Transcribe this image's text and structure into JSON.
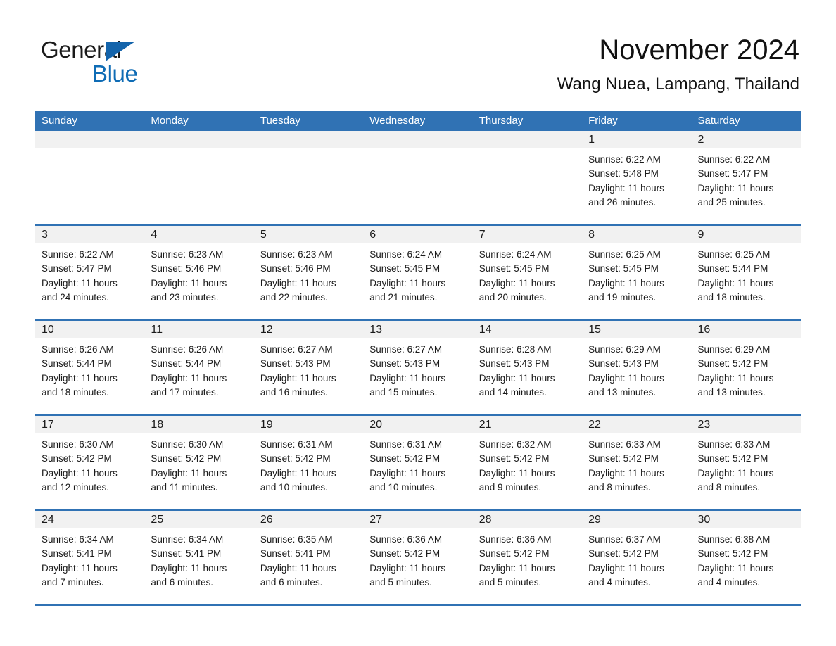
{
  "brand": {
    "name_part1": "General",
    "name_part2": "Blue",
    "triangle_icon": "blue-triangle-icon",
    "colors": {
      "black": "#1a1a1a",
      "blue": "#0f6cb5",
      "header_blue": "#3072b4",
      "day_strip_gray": "#f1f1f1"
    }
  },
  "header": {
    "month_title": "November 2024",
    "location": "Wang Nuea, Lampang, Thailand"
  },
  "calendar": {
    "weekdays": [
      "Sunday",
      "Monday",
      "Tuesday",
      "Wednesday",
      "Thursday",
      "Friday",
      "Saturday"
    ],
    "weeks": [
      [
        {
          "day": "",
          "sunrise": "",
          "sunset": "",
          "daylight_line1": "",
          "daylight_line2": "",
          "empty": true
        },
        {
          "day": "",
          "sunrise": "",
          "sunset": "",
          "daylight_line1": "",
          "daylight_line2": "",
          "empty": true
        },
        {
          "day": "",
          "sunrise": "",
          "sunset": "",
          "daylight_line1": "",
          "daylight_line2": "",
          "empty": true
        },
        {
          "day": "",
          "sunrise": "",
          "sunset": "",
          "daylight_line1": "",
          "daylight_line2": "",
          "empty": true
        },
        {
          "day": "",
          "sunrise": "",
          "sunset": "",
          "daylight_line1": "",
          "daylight_line2": "",
          "empty": true
        },
        {
          "day": "1",
          "sunrise": "Sunrise: 6:22 AM",
          "sunset": "Sunset: 5:48 PM",
          "daylight_line1": "Daylight: 11 hours",
          "daylight_line2": "and 26 minutes.",
          "empty": false
        },
        {
          "day": "2",
          "sunrise": "Sunrise: 6:22 AM",
          "sunset": "Sunset: 5:47 PM",
          "daylight_line1": "Daylight: 11 hours",
          "daylight_line2": "and 25 minutes.",
          "empty": false
        }
      ],
      [
        {
          "day": "3",
          "sunrise": "Sunrise: 6:22 AM",
          "sunset": "Sunset: 5:47 PM",
          "daylight_line1": "Daylight: 11 hours",
          "daylight_line2": "and 24 minutes.",
          "empty": false
        },
        {
          "day": "4",
          "sunrise": "Sunrise: 6:23 AM",
          "sunset": "Sunset: 5:46 PM",
          "daylight_line1": "Daylight: 11 hours",
          "daylight_line2": "and 23 minutes.",
          "empty": false
        },
        {
          "day": "5",
          "sunrise": "Sunrise: 6:23 AM",
          "sunset": "Sunset: 5:46 PM",
          "daylight_line1": "Daylight: 11 hours",
          "daylight_line2": "and 22 minutes.",
          "empty": false
        },
        {
          "day": "6",
          "sunrise": "Sunrise: 6:24 AM",
          "sunset": "Sunset: 5:45 PM",
          "daylight_line1": "Daylight: 11 hours",
          "daylight_line2": "and 21 minutes.",
          "empty": false
        },
        {
          "day": "7",
          "sunrise": "Sunrise: 6:24 AM",
          "sunset": "Sunset: 5:45 PM",
          "daylight_line1": "Daylight: 11 hours",
          "daylight_line2": "and 20 minutes.",
          "empty": false
        },
        {
          "day": "8",
          "sunrise": "Sunrise: 6:25 AM",
          "sunset": "Sunset: 5:45 PM",
          "daylight_line1": "Daylight: 11 hours",
          "daylight_line2": "and 19 minutes.",
          "empty": false
        },
        {
          "day": "9",
          "sunrise": "Sunrise: 6:25 AM",
          "sunset": "Sunset: 5:44 PM",
          "daylight_line1": "Daylight: 11 hours",
          "daylight_line2": "and 18 minutes.",
          "empty": false
        }
      ],
      [
        {
          "day": "10",
          "sunrise": "Sunrise: 6:26 AM",
          "sunset": "Sunset: 5:44 PM",
          "daylight_line1": "Daylight: 11 hours",
          "daylight_line2": "and 18 minutes.",
          "empty": false
        },
        {
          "day": "11",
          "sunrise": "Sunrise: 6:26 AM",
          "sunset": "Sunset: 5:44 PM",
          "daylight_line1": "Daylight: 11 hours",
          "daylight_line2": "and 17 minutes.",
          "empty": false
        },
        {
          "day": "12",
          "sunrise": "Sunrise: 6:27 AM",
          "sunset": "Sunset: 5:43 PM",
          "daylight_line1": "Daylight: 11 hours",
          "daylight_line2": "and 16 minutes.",
          "empty": false
        },
        {
          "day": "13",
          "sunrise": "Sunrise: 6:27 AM",
          "sunset": "Sunset: 5:43 PM",
          "daylight_line1": "Daylight: 11 hours",
          "daylight_line2": "and 15 minutes.",
          "empty": false
        },
        {
          "day": "14",
          "sunrise": "Sunrise: 6:28 AM",
          "sunset": "Sunset: 5:43 PM",
          "daylight_line1": "Daylight: 11 hours",
          "daylight_line2": "and 14 minutes.",
          "empty": false
        },
        {
          "day": "15",
          "sunrise": "Sunrise: 6:29 AM",
          "sunset": "Sunset: 5:43 PM",
          "daylight_line1": "Daylight: 11 hours",
          "daylight_line2": "and 13 minutes.",
          "empty": false
        },
        {
          "day": "16",
          "sunrise": "Sunrise: 6:29 AM",
          "sunset": "Sunset: 5:42 PM",
          "daylight_line1": "Daylight: 11 hours",
          "daylight_line2": "and 13 minutes.",
          "empty": false
        }
      ],
      [
        {
          "day": "17",
          "sunrise": "Sunrise: 6:30 AM",
          "sunset": "Sunset: 5:42 PM",
          "daylight_line1": "Daylight: 11 hours",
          "daylight_line2": "and 12 minutes.",
          "empty": false
        },
        {
          "day": "18",
          "sunrise": "Sunrise: 6:30 AM",
          "sunset": "Sunset: 5:42 PM",
          "daylight_line1": "Daylight: 11 hours",
          "daylight_line2": "and 11 minutes.",
          "empty": false
        },
        {
          "day": "19",
          "sunrise": "Sunrise: 6:31 AM",
          "sunset": "Sunset: 5:42 PM",
          "daylight_line1": "Daylight: 11 hours",
          "daylight_line2": "and 10 minutes.",
          "empty": false
        },
        {
          "day": "20",
          "sunrise": "Sunrise: 6:31 AM",
          "sunset": "Sunset: 5:42 PM",
          "daylight_line1": "Daylight: 11 hours",
          "daylight_line2": "and 10 minutes.",
          "empty": false
        },
        {
          "day": "21",
          "sunrise": "Sunrise: 6:32 AM",
          "sunset": "Sunset: 5:42 PM",
          "daylight_line1": "Daylight: 11 hours",
          "daylight_line2": "and 9 minutes.",
          "empty": false
        },
        {
          "day": "22",
          "sunrise": "Sunrise: 6:33 AM",
          "sunset": "Sunset: 5:42 PM",
          "daylight_line1": "Daylight: 11 hours",
          "daylight_line2": "and 8 minutes.",
          "empty": false
        },
        {
          "day": "23",
          "sunrise": "Sunrise: 6:33 AM",
          "sunset": "Sunset: 5:42 PM",
          "daylight_line1": "Daylight: 11 hours",
          "daylight_line2": "and 8 minutes.",
          "empty": false
        }
      ],
      [
        {
          "day": "24",
          "sunrise": "Sunrise: 6:34 AM",
          "sunset": "Sunset: 5:41 PM",
          "daylight_line1": "Daylight: 11 hours",
          "daylight_line2": "and 7 minutes.",
          "empty": false
        },
        {
          "day": "25",
          "sunrise": "Sunrise: 6:34 AM",
          "sunset": "Sunset: 5:41 PM",
          "daylight_line1": "Daylight: 11 hours",
          "daylight_line2": "and 6 minutes.",
          "empty": false
        },
        {
          "day": "26",
          "sunrise": "Sunrise: 6:35 AM",
          "sunset": "Sunset: 5:41 PM",
          "daylight_line1": "Daylight: 11 hours",
          "daylight_line2": "and 6 minutes.",
          "empty": false
        },
        {
          "day": "27",
          "sunrise": "Sunrise: 6:36 AM",
          "sunset": "Sunset: 5:42 PM",
          "daylight_line1": "Daylight: 11 hours",
          "daylight_line2": "and 5 minutes.",
          "empty": false
        },
        {
          "day": "28",
          "sunrise": "Sunrise: 6:36 AM",
          "sunset": "Sunset: 5:42 PM",
          "daylight_line1": "Daylight: 11 hours",
          "daylight_line2": "and 5 minutes.",
          "empty": false
        },
        {
          "day": "29",
          "sunrise": "Sunrise: 6:37 AM",
          "sunset": "Sunset: 5:42 PM",
          "daylight_line1": "Daylight: 11 hours",
          "daylight_line2": "and 4 minutes.",
          "empty": false
        },
        {
          "day": "30",
          "sunrise": "Sunrise: 6:38 AM",
          "sunset": "Sunset: 5:42 PM",
          "daylight_line1": "Daylight: 11 hours",
          "daylight_line2": "and 4 minutes.",
          "empty": false
        }
      ]
    ]
  }
}
